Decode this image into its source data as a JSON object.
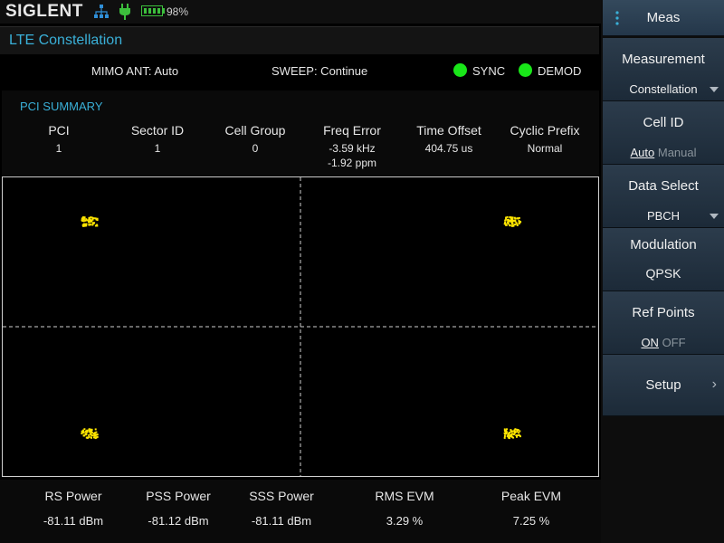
{
  "brand": "SIGLENT",
  "battery": {
    "percent": "98%",
    "level": 0.98
  },
  "title": "LTE Constellation",
  "status": {
    "mimo": "MIMO ANT: Auto",
    "sweep": "SWEEP: Continue",
    "sync": "SYNC",
    "demod": "DEMOD",
    "led_color": "#19e619"
  },
  "summary": {
    "title": "PCI SUMMARY",
    "headers": [
      "PCI",
      "Sector ID",
      "Cell Group",
      "Freq Error",
      "Time Offset",
      "Cyclic Prefix"
    ],
    "values": [
      "1",
      "1",
      "0",
      "-3.59 kHz",
      "404.75 us",
      "Normal"
    ],
    "freq_error_ppm": "-1.92 ppm"
  },
  "chart_data": {
    "type": "scatter",
    "title": "",
    "xlabel": "",
    "ylabel": "",
    "xlim": [
      -1,
      1
    ],
    "ylim": [
      -1,
      1
    ],
    "grid": "center-crosshair-dashed",
    "series": [
      {
        "points": [
          [
            -0.71,
            0.71
          ],
          [
            0.71,
            0.71
          ],
          [
            -0.71,
            -0.71
          ],
          [
            0.71,
            -0.71
          ]
        ],
        "color": "#ffe600"
      }
    ]
  },
  "metrics": {
    "headers": [
      "RS Power",
      "PSS Power",
      "SSS Power",
      "RMS EVM",
      "Peak EVM"
    ],
    "values": [
      "-81.11 dBm",
      "-81.12 dBm",
      "-81.11 dBm",
      "3.29 %",
      "7.25 %"
    ]
  },
  "softkeys": {
    "meas": "Meas",
    "measurement": {
      "label": "Measurement",
      "value": "Constellation"
    },
    "cell_id": {
      "label": "Cell ID",
      "opt1": "Auto",
      "opt2": "Manual"
    },
    "data_select": {
      "label": "Data Select",
      "value": "PBCH"
    },
    "modulation": {
      "label": "Modulation",
      "value": "QPSK"
    },
    "ref_points": {
      "label": "Ref Points",
      "opt1": "ON",
      "opt2": "OFF"
    },
    "setup": {
      "label": "Setup"
    }
  },
  "colors": {
    "accent": "#3ab0d8",
    "symbol": "#ffe600",
    "ok": "#19e619"
  }
}
